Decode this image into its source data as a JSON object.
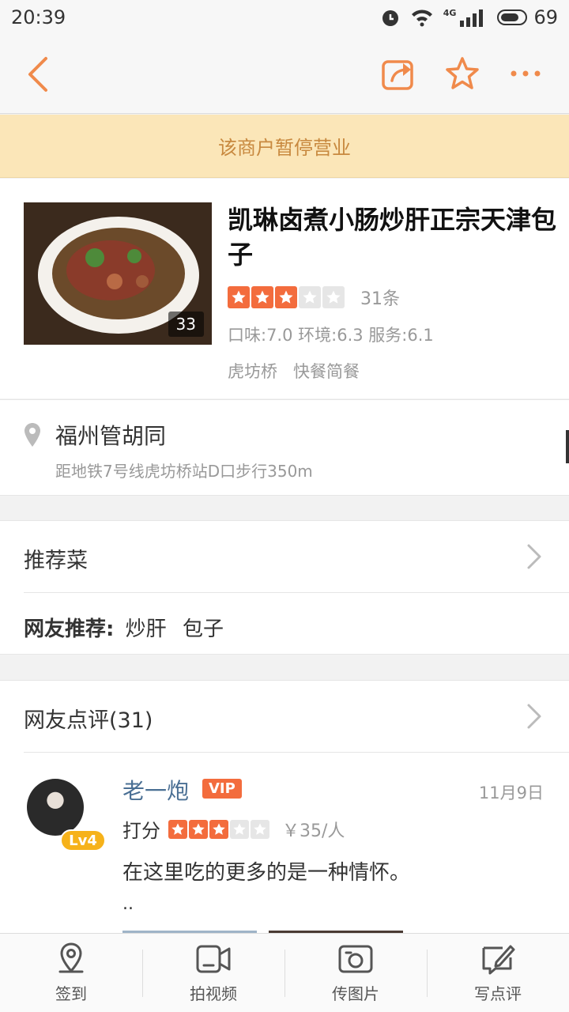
{
  "status_bar": {
    "time": "20:39",
    "network": "4G",
    "battery": "69"
  },
  "nav": {
    "back_icon": "back-arrow-icon",
    "share_icon": "share-icon",
    "favorite_icon": "star-icon",
    "more_icon": "more-icon"
  },
  "notice": {
    "text": "该商户暂停营业"
  },
  "shop": {
    "name": "凯琳卤煮小肠炒肝正宗天津包子",
    "photo_count": "33",
    "rating_stars": 3,
    "review_count": "31条",
    "scores": "口味:7.0 环境:6.3 服务:6.1",
    "tags": [
      "虎坊桥",
      "快餐简餐"
    ]
  },
  "address": {
    "name": "福州管胡同",
    "subway": "距地铁7号线虎坊桥站D口步行350m"
  },
  "recommend": {
    "title": "推荐菜",
    "label": "网友推荐:",
    "items": [
      "炒肝",
      "包子"
    ]
  },
  "reviews": {
    "title": "网友点评(31)",
    "items": [
      {
        "user": "老一炮",
        "vip": "VIP",
        "level": "Lv4",
        "date": "11月9日",
        "score_label": "打分",
        "stars": 3,
        "price": "￥35/人",
        "text": "在这里吃的更多的是一种情怀。",
        "more": ".."
      }
    ]
  },
  "tabbar": {
    "items": [
      {
        "label": "签到",
        "icon": "location-pin-icon"
      },
      {
        "label": "拍视频",
        "icon": "video-camera-icon"
      },
      {
        "label": "传图片",
        "icon": "photo-icon"
      },
      {
        "label": "写点评",
        "icon": "write-review-icon"
      }
    ]
  },
  "colors": {
    "accent": "#f36c3d",
    "notice_bg": "#fbe6b8",
    "notice_text": "#c8893f",
    "nav_icon": "#f08a4b"
  }
}
